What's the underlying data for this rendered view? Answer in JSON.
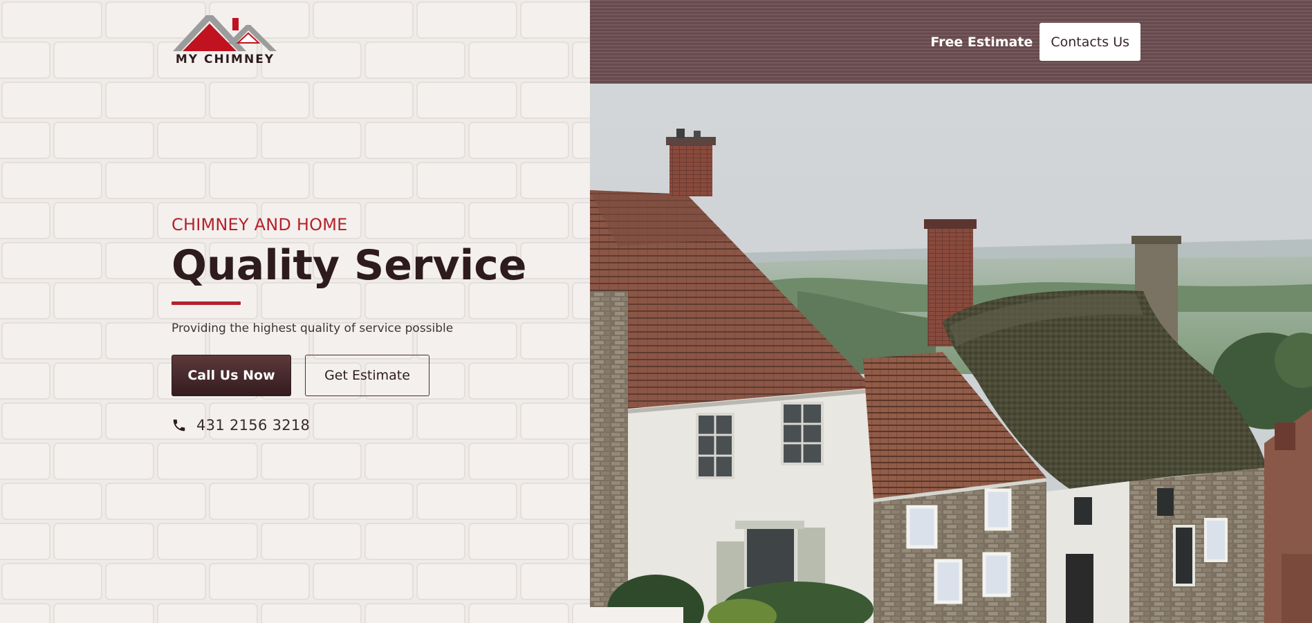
{
  "brand": {
    "name": "MY CHIMNEY"
  },
  "nav": {
    "free_estimate": "Free Estimate",
    "contacts": "Contacts Us"
  },
  "hero": {
    "eyebrow": "CHIMNEY AND HOME",
    "headline": "Quality Service",
    "subtitle": "Providing the highest quality of service possible",
    "primary_button": "Call Us Now",
    "secondary_button": "Get Estimate",
    "phone": "431 2156 3218"
  },
  "icons": {
    "phone": "phone-icon",
    "logo": "house-roof-logo-icon"
  },
  "colors": {
    "accent_red": "#b5222b",
    "dark_brown": "#2e1b1d",
    "topbar": "#6d4f52",
    "wall": "#efebe8"
  }
}
